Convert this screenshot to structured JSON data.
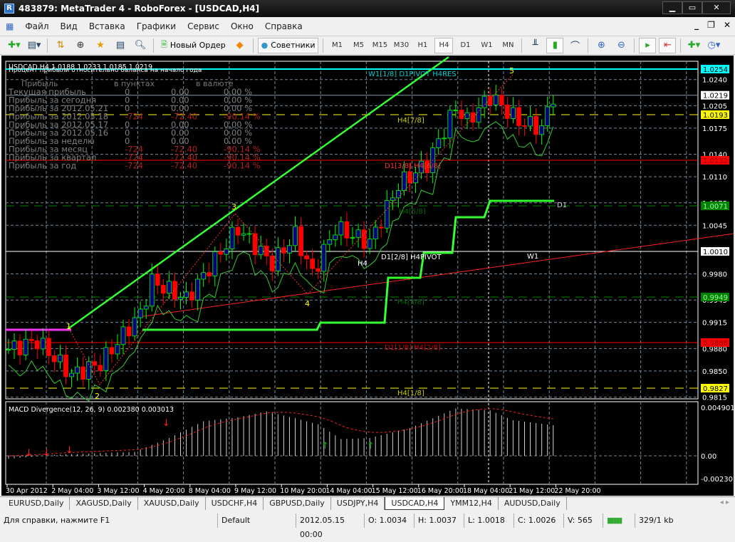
{
  "window": {
    "title": "483879: MetaTrader 4 - RoboForex - [USDCAD,H4]",
    "minimize": "▁",
    "maximize": "▭",
    "close": "✕"
  },
  "menu": [
    "Файл",
    "Вид",
    "Вставка",
    "Графики",
    "Сервис",
    "Окно",
    "Справка"
  ],
  "mdi": {
    "minimize": "_",
    "restore": "❐",
    "close": "✕"
  },
  "toolbar": {
    "new_order": "Новый Ордер",
    "experts": "Советники",
    "timeframes": [
      "M1",
      "M5",
      "M15",
      "M30",
      "H1",
      "H4",
      "D1",
      "W1",
      "MN"
    ],
    "selected_tf": "H4"
  },
  "chart": {
    "header": "USDCAD,H4  1.0188 1.0233 1.0185 1.0219",
    "subtitle": "Процент прибыли относительно баланса на начало года",
    "table_headers": [
      "Прибыль",
      "в пунктах",
      "в валюте"
    ],
    "rows": [
      {
        "label": "Текущая прибыль",
        "points": "0",
        "money": "0.00",
        "pct": "0.00 %",
        "loss": false
      },
      {
        "label": "Прибыль за сегодня",
        "points": "0",
        "money": "0.00",
        "pct": "0.00 %",
        "loss": false
      },
      {
        "label": "Прибыль за 2012.05.21",
        "points": "0",
        "money": "0.00",
        "pct": "0.00 %",
        "loss": false
      },
      {
        "label": "Прибыль за 2012.05.18",
        "points": "-724",
        "money": "-72.40",
        "pct": "-90.14 %",
        "loss": true
      },
      {
        "label": "Прибыль за 2012.05.17",
        "points": "0",
        "money": "0.00",
        "pct": "0.00 %",
        "loss": false
      },
      {
        "label": "Прибыль за 2012.05.16",
        "points": "0",
        "money": "0.00",
        "pct": "0.00 %",
        "loss": false
      },
      {
        "label": "Прибыль за неделю",
        "points": "0",
        "money": "0.00",
        "pct": "0.00 %",
        "loss": false
      },
      {
        "label": "Прибыль за месяц",
        "points": "-724",
        "money": "-72.40",
        "pct": "-90.14 %",
        "loss": true
      },
      {
        "label": "Прибыль за квартал",
        "points": "-724",
        "money": "-72.40",
        "pct": "-90.14 %",
        "loss": true
      },
      {
        "label": "Прибыль за год",
        "points": "-724",
        "money": "-72.40",
        "pct": "-90.14 %",
        "loss": true
      }
    ],
    "price_ticks": [
      "1.0240",
      "1.0205",
      "1.0175",
      "1.0140",
      "1.0110",
      "1.0075",
      "1.0045",
      "1.0010",
      "0.9980",
      "0.9945",
      "0.9915",
      "0.9880",
      "0.9850",
      "0.9815"
    ],
    "price_tags": [
      {
        "value": "1.0254",
        "bg": "#00ffff",
        "fg": "#000"
      },
      {
        "value": "1.0219",
        "bg": "#ffffff",
        "fg": "#000"
      },
      {
        "value": "1.0193",
        "bg": "#ffff00",
        "fg": "#000"
      },
      {
        "value": "1.0132",
        "bg": "#ff0000",
        "fg": "#800"
      },
      {
        "value": "1.0071",
        "bg": "#008000",
        "fg": "#9f9"
      },
      {
        "value": "1.0010",
        "bg": "#ffffff",
        "fg": "#000"
      },
      {
        "value": "0.9949",
        "bg": "#008000",
        "fg": "#9f9"
      },
      {
        "value": "0.9888",
        "bg": "#ff0000",
        "fg": "#800"
      },
      {
        "value": "0.9827",
        "bg": "#ffff00",
        "fg": "#000"
      }
    ],
    "level_labels": {
      "w1res": "W1[1/8] D1PIVOT H4RES",
      "h478": "H4[7/8]",
      "d138": "D1[3/8] H4[6/8]",
      "h458": "H4[5/8]",
      "d1": "D1",
      "pivot": "D1[2/8] H4PIVOT",
      "h4": "H4",
      "w1": "W1",
      "h438": "H4[3/8]",
      "d118": "D1[1/8] H4[2/8]",
      "h418": "H4[1/8]"
    },
    "wave_labels": [
      "1",
      "2",
      "3",
      "4",
      "5"
    ],
    "candle_keypoints": [
      [
        0,
        0.9879
      ],
      [
        5,
        0.989
      ],
      [
        11,
        0.9845
      ],
      [
        16,
        0.986
      ],
      [
        23,
        0.9927
      ],
      [
        25,
        0.997
      ],
      [
        31,
        0.9946
      ],
      [
        40,
        1.0041
      ],
      [
        46,
        0.9994
      ],
      [
        50,
        1.0032
      ],
      [
        53,
        0.998
      ],
      [
        57,
        1.0041
      ],
      [
        63,
        1.0022
      ],
      [
        68,
        1.0099
      ],
      [
        73,
        1.0127
      ],
      [
        78,
        1.0203
      ],
      [
        80,
        1.0184
      ],
      [
        84,
        1.0218
      ],
      [
        89,
        1.0184
      ],
      [
        93,
        1.0175
      ],
      [
        95,
        1.0219
      ]
    ],
    "colors": {
      "bull": "#00ff00",
      "bear": "#ff0000",
      "bull_body": "#000080",
      "grid": "#778899"
    }
  },
  "macd": {
    "label": "MACD Divergence(12, 26, 9) 0.002380 0.003013",
    "ticks": [
      "0.004901",
      "0.00",
      "-0.00230"
    ],
    "hist_keypoints": [
      [
        0,
        -0.0003
      ],
      [
        8,
        0.0001
      ],
      [
        22,
        0.0004
      ],
      [
        28,
        0.0018
      ],
      [
        34,
        0.0035
      ],
      [
        40,
        0.0039
      ],
      [
        45,
        0.0045
      ],
      [
        50,
        0.0038
      ],
      [
        54,
        0.0032
      ],
      [
        58,
        0.0017
      ],
      [
        63,
        0.0018
      ],
      [
        70,
        0.0028
      ],
      [
        78,
        0.0048
      ],
      [
        84,
        0.0046
      ],
      [
        88,
        0.0036
      ],
      [
        95,
        0.0031
      ]
    ]
  },
  "time_ticks": [
    "30 Apr 2012",
    "2 May 04:00",
    "3 May 12:00",
    "4 May 20:00",
    "8 May 04:00",
    "9 May 12:00",
    "10 May 20:00",
    "14 May 04:00",
    "15 May 12:00",
    "16 May 20:00",
    "18 May 04:00",
    "21 May 12:00",
    "22 May 20:00"
  ],
  "tabs": [
    "EURUSD,Daily",
    "XAGUSD,Daily",
    "XAUUSD,Daily",
    "USDCHF,H4",
    "GBPUSD,Daily",
    "USDJPY,H4",
    "USDCAD,H4",
    "YMM12,H4",
    "AUDUSD,Daily"
  ],
  "active_tab": "USDCAD,H4",
  "status": {
    "help": "Для справки, нажмите F1",
    "profile": "Default",
    "time": "2012.05.15 00:00",
    "open": "O: 1.0034",
    "high": "H: 1.0037",
    "low": "L: 1.0018",
    "close": "C: 1.0026",
    "volume": "V: 565",
    "traffic": "329/1 kb"
  }
}
